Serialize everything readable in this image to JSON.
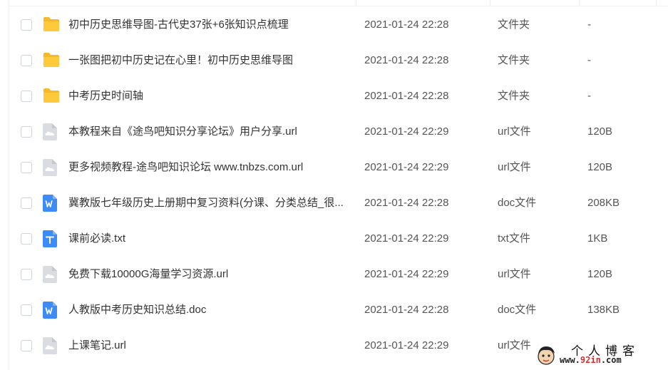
{
  "colors": {
    "folder": "#FFC93C",
    "folder_tab": "#F7B928",
    "doc_icon": "#3D8BF5",
    "txt_icon": "#3D8BF5",
    "url_icon": "#D9DCE1",
    "watermark_accent": "#d32f2f"
  },
  "files": [
    {
      "name": "初中历史思维导图-古代史37张+6张知识点梳理",
      "date": "2021-01-24 22:28",
      "type": "文件夹",
      "size": "-",
      "icon": "folder-icon"
    },
    {
      "name": "一张图把初中历史记在心里！初中历史思维导图",
      "date": "2021-01-24 22:28",
      "type": "文件夹",
      "size": "-",
      "icon": "folder-icon"
    },
    {
      "name": "中考历史时间轴",
      "date": "2021-01-24 22:28",
      "type": "文件夹",
      "size": "-",
      "icon": "folder-icon"
    },
    {
      "name": "本教程来自《途鸟吧知识分享论坛》用户分享.url",
      "date": "2021-01-24 22:29",
      "type": "url文件",
      "size": "120B",
      "icon": "cloud-file-icon"
    },
    {
      "name": "更多视频教程-途鸟吧知识论坛 www.tnbzs.com.url",
      "date": "2021-01-24 22:29",
      "type": "url文件",
      "size": "120B",
      "icon": "cloud-file-icon"
    },
    {
      "name": "冀教版七年级历史上册期中复习资料(分课、分类总结_很...",
      "date": "2021-01-24 22:28",
      "type": "doc文件",
      "size": "208KB",
      "icon": "word-doc-icon"
    },
    {
      "name": "课前必读.txt",
      "date": "2021-01-24 22:29",
      "type": "txt文件",
      "size": "1KB",
      "icon": "text-file-icon"
    },
    {
      "name": "免费下载10000G海量学习资源.url",
      "date": "2021-01-24 22:29",
      "type": "url文件",
      "size": "120B",
      "icon": "cloud-file-icon"
    },
    {
      "name": "人教版中考历史知识总结.doc",
      "date": "2021-01-24 22:28",
      "type": "doc文件",
      "size": "138KB",
      "icon": "word-doc-icon"
    },
    {
      "name": "上课笔记.url",
      "date": "2021-01-24 22:29",
      "type": "url文件",
      "size": "",
      "icon": "cloud-file-icon"
    }
  ],
  "watermark": {
    "title": "个人博客",
    "url_prefix": "www.",
    "url_accent": "92in",
    "url_suffix": ".com"
  }
}
